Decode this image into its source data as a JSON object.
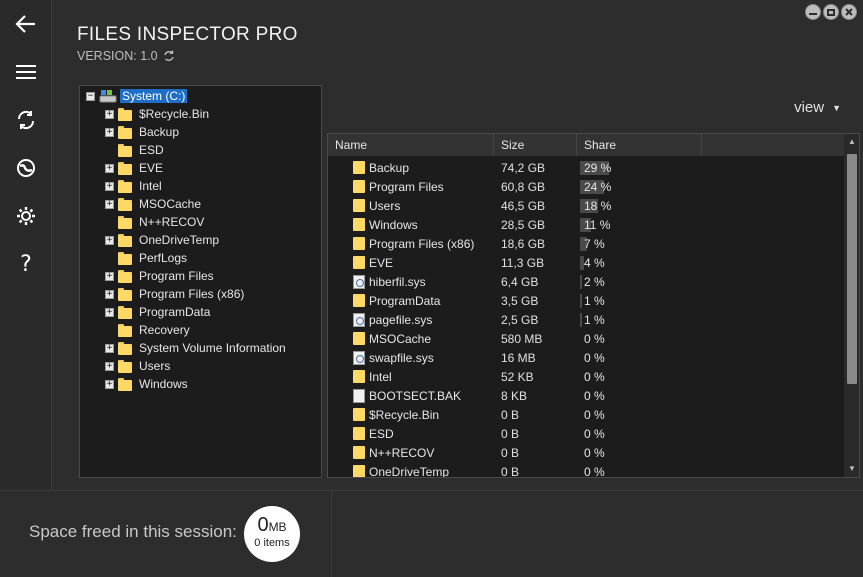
{
  "header": {
    "title": "FILES INSPECTOR PRO",
    "version": "VERSION: 1.0"
  },
  "nav": {
    "items": [
      {
        "name": "back-icon"
      },
      {
        "name": "menu-icon"
      },
      {
        "name": "refresh-icon"
      },
      {
        "name": "globe-icon"
      },
      {
        "name": "gear-icon"
      },
      {
        "name": "help-icon",
        "glyph": "?"
      }
    ]
  },
  "tree": {
    "root": "System (C:)",
    "items": [
      {
        "label": "$Recycle.Bin",
        "expandable": true
      },
      {
        "label": "Backup",
        "expandable": true
      },
      {
        "label": "ESD",
        "expandable": false
      },
      {
        "label": "EVE",
        "expandable": true
      },
      {
        "label": "Intel",
        "expandable": true
      },
      {
        "label": "MSOCache",
        "expandable": true
      },
      {
        "label": "N++RECOV",
        "expandable": false
      },
      {
        "label": "OneDriveTemp",
        "expandable": true
      },
      {
        "label": "PerfLogs",
        "expandable": false
      },
      {
        "label": "Program Files",
        "expandable": true
      },
      {
        "label": "Program Files (x86)",
        "expandable": true
      },
      {
        "label": "ProgramData",
        "expandable": true
      },
      {
        "label": "Recovery",
        "expandable": false
      },
      {
        "label": "System Volume Information",
        "expandable": true
      },
      {
        "label": "Users",
        "expandable": true
      },
      {
        "label": "Windows",
        "expandable": true
      }
    ]
  },
  "view": {
    "label": "view",
    "caret": "▼"
  },
  "list": {
    "columns": [
      "Name",
      "Size",
      "Share"
    ],
    "rows": [
      {
        "name": "Backup",
        "size": "74,2 GB",
        "share": "29 %",
        "share_value": 29,
        "type": "folder"
      },
      {
        "name": "Program Files",
        "size": "60,8 GB",
        "share": "24 %",
        "share_value": 24,
        "type": "folder"
      },
      {
        "name": "Users",
        "size": "46,5 GB",
        "share": "18 %",
        "share_value": 18,
        "type": "folder"
      },
      {
        "name": "Windows",
        "size": "28,5 GB",
        "share": "11 %",
        "share_value": 11,
        "type": "folder"
      },
      {
        "name": "Program Files (x86)",
        "size": "18,6 GB",
        "share": "7 %",
        "share_value": 7,
        "type": "folder"
      },
      {
        "name": "EVE",
        "size": "11,3 GB",
        "share": "4 %",
        "share_value": 4,
        "type": "folder"
      },
      {
        "name": "hiberfil.sys",
        "size": "6,4 GB",
        "share": "2 %",
        "share_value": 2,
        "type": "sys"
      },
      {
        "name": "ProgramData",
        "size": "3,5 GB",
        "share": "1 %",
        "share_value": 1,
        "type": "folder"
      },
      {
        "name": "pagefile.sys",
        "size": "2,5 GB",
        "share": "1 %",
        "share_value": 1,
        "type": "sys"
      },
      {
        "name": "MSOCache",
        "size": "580 MB",
        "share": "0 %",
        "share_value": 0,
        "type": "folder"
      },
      {
        "name": "swapfile.sys",
        "size": "16 MB",
        "share": "0 %",
        "share_value": 0,
        "type": "sys"
      },
      {
        "name": "Intel",
        "size": "52 KB",
        "share": "0 %",
        "share_value": 0,
        "type": "folder"
      },
      {
        "name": "BOOTSECT.BAK",
        "size": "8 KB",
        "share": "0 %",
        "share_value": 0,
        "type": "file"
      },
      {
        "name": "$Recycle.Bin",
        "size": "0 B",
        "share": "0 %",
        "share_value": 0,
        "type": "folder"
      },
      {
        "name": "ESD",
        "size": "0 B",
        "share": "0 %",
        "share_value": 0,
        "type": "folder"
      },
      {
        "name": "N++RECOV",
        "size": "0 B",
        "share": "0 %",
        "share_value": 0,
        "type": "folder"
      },
      {
        "name": "OneDriveTemp",
        "size": "0 B",
        "share": "0 %",
        "share_value": 0,
        "type": "folder"
      }
    ]
  },
  "footer": {
    "freed_label": "Space freed in this session:",
    "freed_value": "0",
    "freed_unit": "MB",
    "freed_items": "0 items"
  },
  "colors": {
    "background": "#2d2d2d",
    "panel": "#1c1c1c",
    "selection": "#1e6ec8",
    "folder": "#ffd966"
  }
}
